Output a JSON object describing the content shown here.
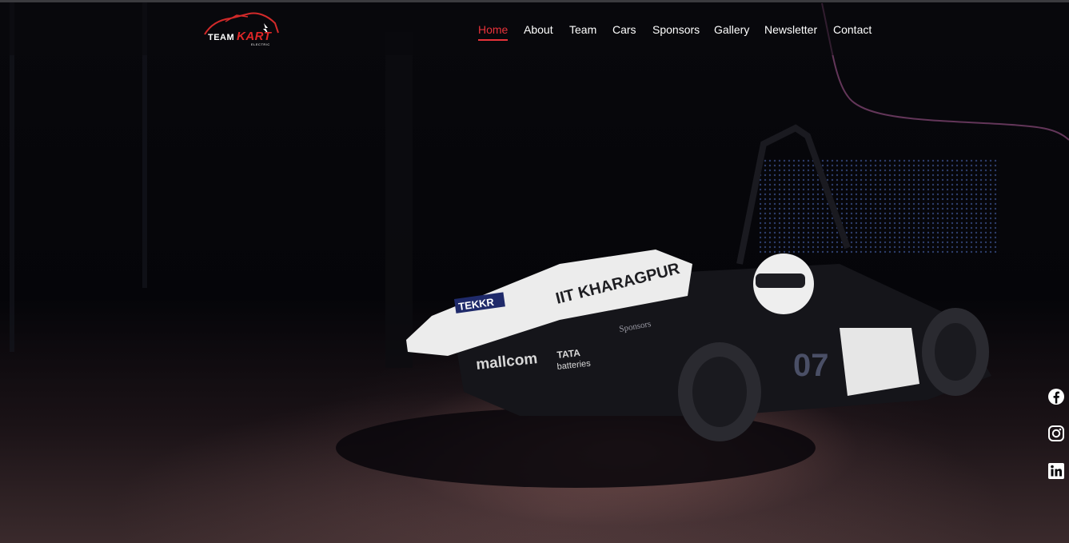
{
  "logo": {
    "team": "TEAM",
    "kart": "KART",
    "sub": "ELECTRIC"
  },
  "nav": {
    "items": [
      {
        "label": "Home",
        "active": true
      },
      {
        "label": "About"
      },
      {
        "label": "Team"
      },
      {
        "label": "Cars"
      },
      {
        "label": "Sponsors"
      },
      {
        "label": "Gallery"
      },
      {
        "label": "Newsletter"
      },
      {
        "label": "Contact"
      }
    ]
  },
  "hero": {
    "nose_text": "IIT KHARAGPUR",
    "car_number": "07",
    "sponsors": [
      "TEKKR",
      "mallcom",
      "TATA",
      "batteries",
      "Sponsors"
    ]
  },
  "social": [
    "facebook-icon",
    "instagram-icon",
    "linkedin-icon"
  ],
  "colors": {
    "accent": "#e8323a",
    "nav_text": "#ffffff",
    "background": "#050508"
  }
}
